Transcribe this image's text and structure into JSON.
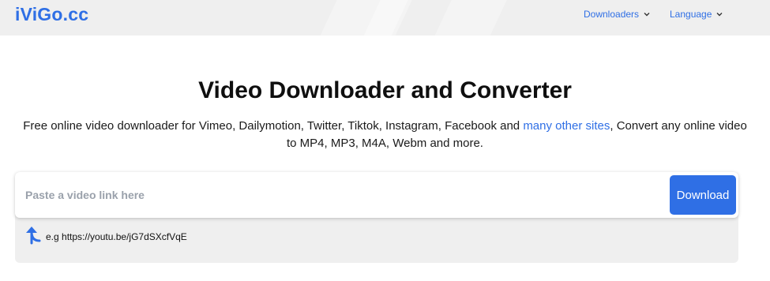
{
  "header": {
    "logo": "iViGo.cc",
    "nav": [
      {
        "label": "Downloaders",
        "icon": "chevron-down-icon"
      },
      {
        "label": "Language",
        "icon": "chevron-down-icon"
      }
    ]
  },
  "hero": {
    "title": "Video Downloader and Converter",
    "desc_before": "Free online video downloader for Vimeo, Dailymotion, Twitter, Tiktok, Instagram, Facebook and ",
    "desc_link": "many other sites",
    "desc_after": ", Convert any online video to MP4, MP3, M4A, Webm and more."
  },
  "search": {
    "placeholder": "Paste a video link here",
    "value": "",
    "button_label": "Download"
  },
  "example": {
    "text": "e.g https://youtu.be/jG7dSXcfVqE",
    "icon": "arrow-up-left-icon"
  },
  "colors": {
    "accent": "#2f6fe5",
    "header_bg": "#efefef",
    "panel_bg": "#efefef"
  }
}
